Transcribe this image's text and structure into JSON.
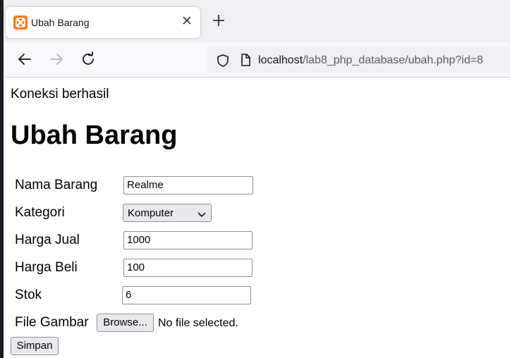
{
  "browser": {
    "tab_title": "Ubah Barang",
    "url_host": "localhost",
    "url_path": "/lab8_php_database/ubah.php?id=8"
  },
  "page": {
    "status": "Koneksi berhasil",
    "heading": "Ubah Barang"
  },
  "form": {
    "nama_barang": {
      "label": "Nama Barang",
      "value": "Realme"
    },
    "kategori": {
      "label": "Kategori",
      "selected": "Komputer"
    },
    "harga_jual": {
      "label": "Harga Jual",
      "value": "1000"
    },
    "harga_beli": {
      "label": "Harga Beli",
      "value": "100"
    },
    "stok": {
      "label": "Stok",
      "value": "6"
    },
    "file_gambar": {
      "label": "File Gambar",
      "button": "Browse...",
      "status": "No file selected."
    },
    "submit_label": "Simpan"
  },
  "icons": {
    "favicon": "xampp-icon",
    "close": "close-icon",
    "new_tab": "plus-icon",
    "back": "back-arrow-icon",
    "forward": "forward-arrow-icon",
    "reload": "reload-icon",
    "shield": "shield-icon",
    "page": "page-icon",
    "dropdown": "chevron-down-icon"
  },
  "colors": {
    "tabstrip_bg": "#f0f0f4",
    "favicon_bg": "#fb7a24",
    "url_path": "#5b5b66"
  }
}
